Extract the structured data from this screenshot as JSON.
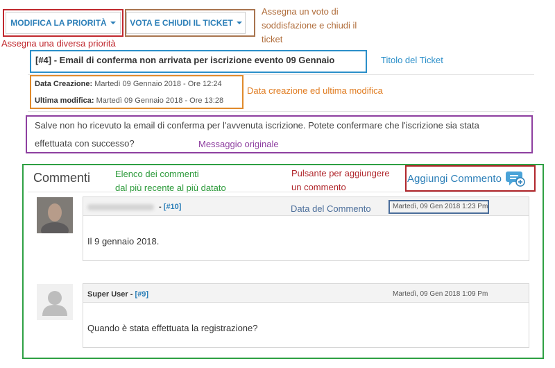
{
  "toolbar": {
    "priority_button": "MODIFICA LA PRIORITÀ",
    "vote_button": "VOTA E CHIUDI IL TICKET"
  },
  "annotations": {
    "priority": "Assegna una diversa priorità",
    "vote": [
      "Assegna un voto di",
      "soddisfazione e chiudi il",
      "ticket"
    ],
    "title": "Titolo del Ticket",
    "dates": "Data creazione ed ultima modifica",
    "message": "Messaggio originale",
    "comment_list": [
      "Elenco dei commenti",
      "dal più recente al più datato"
    ],
    "add_button": [
      "Pulsante per aggiungere",
      "un commento"
    ],
    "comment_date": "Data del Commento"
  },
  "ticket": {
    "title": "[#4] - Email di conferma non arrivata per iscrizione evento 09 Gennaio",
    "created_label": "Data Creazione:",
    "created_value": "Martedì 09 Gennaio 2018 - Ore 12:24",
    "modified_label": "Ultima modifica:",
    "modified_value": "Martedì 09 Gennaio 2018 - Ore 13:28",
    "message_line1": "Salve non ho ricevuto la email di conferma per l'avvenuta iscrizione. Potete confermare che l'iscrizione sia stata",
    "message_line2": "effettuata con successo?"
  },
  "comments_section": {
    "title": "Commenti",
    "add_label": "Aggiungi Commento"
  },
  "comments": [
    {
      "author": "",
      "separator": " - ",
      "id": "[#10]",
      "date": "Martedì, 09 Gen 2018 1:23 Pm",
      "text": "Il 9 gennaio 2018."
    },
    {
      "author": "Super User",
      "separator": " - ",
      "id": "[#9]",
      "date": "Martedì, 09 Gen 2018 1:09 Pm",
      "text": "Quando è stata effettuata la registrazione?"
    }
  ],
  "colors": {
    "link": "#2c7fb8",
    "red": "#c0282e",
    "brown": "#b06d3b",
    "blue": "#2b8fc9",
    "orange": "#e07b1f",
    "purple": "#8e3fa0",
    "green": "#2c9a3a",
    "navy": "#4a6d9a"
  },
  "icons": {
    "caret": "caret-down-icon",
    "add_comment": "chat-bubble-plus-icon",
    "avatar": "user-silhouette-icon"
  }
}
